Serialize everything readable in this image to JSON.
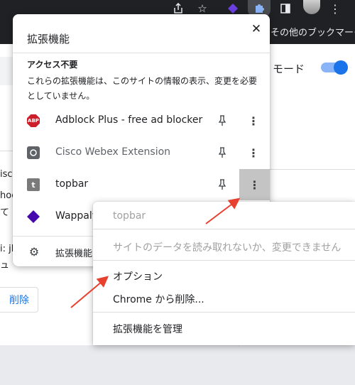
{
  "browser": {
    "bookmarks_other": "その他のブックマーク"
  },
  "page": {
    "mode_label": "モード",
    "fragments": [
      "isco",
      "hoog",
      "て",
      "i: jl",
      "ュ"
    ],
    "remove_button": "削除"
  },
  "popup": {
    "title": "拡張機能",
    "close_glyph": "✕",
    "access_heading": "アクセス不要",
    "access_desc": "これらの拡張機能は、このサイトの情報の表示、変更を必要としていません。",
    "extensions": [
      {
        "name": "Adblock Plus - free ad blocker",
        "icon": "abp-icon",
        "icon_text": "ABP"
      },
      {
        "name": "Cisco Webex Extension",
        "icon": "webex-icon",
        "icon_text": ""
      },
      {
        "name": "topbar",
        "icon": "topbar-icon",
        "icon_text": "t"
      },
      {
        "name": "Wappalyzer",
        "icon": "wappalyzer-icon",
        "icon_text": ""
      }
    ],
    "manage_label": "拡張機能を管理"
  },
  "context_menu": {
    "header": "topbar",
    "site_access": "サイトのデータを読み取れないか、変更できません",
    "options": "オプション",
    "remove": "Chrome から削除...",
    "manage": "拡張機能を管理"
  },
  "colors": {
    "toolbar": "#202124",
    "accent": "#1a73e8",
    "annotation_arrow": "#e8402e",
    "active_menu_bg": "#c4c4c4"
  }
}
